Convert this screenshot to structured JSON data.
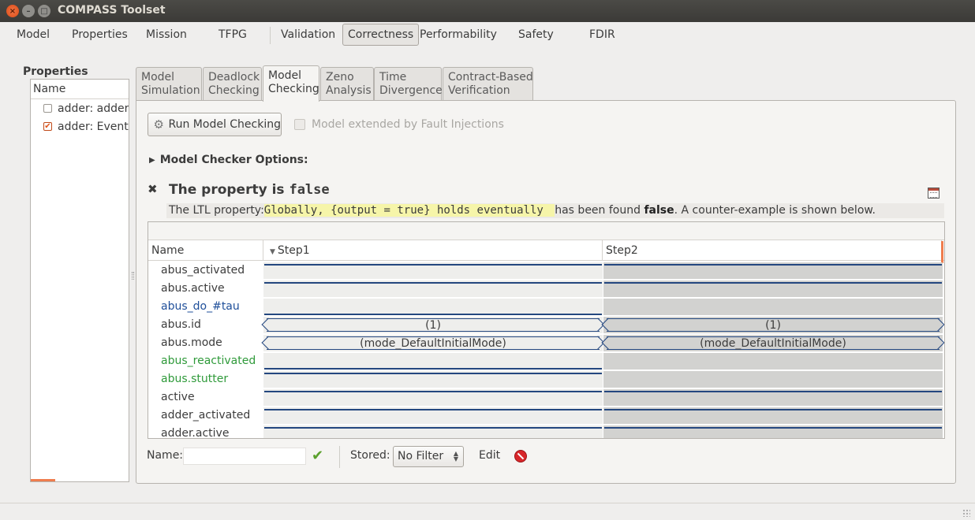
{
  "window": {
    "title": "COMPASS Toolset"
  },
  "menu": {
    "items": [
      "Model",
      "Properties",
      "Mission",
      "TFPG",
      "Validation",
      "Correctness",
      "Performability",
      "Safety",
      "FDIR"
    ],
    "active": "Correctness"
  },
  "properties": {
    "title": "Properties",
    "column": "Name",
    "items": [
      {
        "label": "adder: adder_",
        "checked": false
      },
      {
        "label": "adder: Eventu",
        "checked": true
      }
    ]
  },
  "subtabs": [
    {
      "label": "Model\nSimulation"
    },
    {
      "label": "Deadlock\nChecking"
    },
    {
      "label": "Model\nChecking"
    },
    {
      "label": "Zeno\nAnalysis"
    },
    {
      "label": "Time\nDivergence"
    },
    {
      "label": "Contract-Based\nVerification"
    }
  ],
  "active_subtab": "Model Checking",
  "run_button": "Run Model Checking",
  "fault_checkbox": {
    "label": "Model extended by Fault Injections",
    "checked": false,
    "enabled": false
  },
  "options_label": "Model Checker Options:",
  "result": {
    "title_prefix": "The property is ",
    "title_value": "false",
    "ltl_prefix": "The LTL property:",
    "ltl_formula": "Globally, {output = true} holds eventually ",
    "ltl_mid": " has been found ",
    "ltl_value": "false",
    "ltl_suffix": ". A counter-example is shown below."
  },
  "trace": {
    "headers": {
      "name": "Name",
      "step1": "Step1",
      "step2": "Step2"
    },
    "rows": [
      {
        "name": "abus_activated",
        "color": "default"
      },
      {
        "name": "abus.active",
        "color": "default"
      },
      {
        "name": "abus_do_#tau",
        "color": "blue"
      },
      {
        "name": "abus.id",
        "color": "default",
        "step1": "(1)",
        "step2": "(1)"
      },
      {
        "name": "abus.mode",
        "color": "default",
        "step1": "(mode_DefaultInitialMode)",
        "step2": "(mode_DefaultInitialMode)"
      },
      {
        "name": "abus_reactivated",
        "color": "green"
      },
      {
        "name": "abus.stutter",
        "color": "green"
      },
      {
        "name": "active",
        "color": "default"
      },
      {
        "name": "adder_activated",
        "color": "default"
      },
      {
        "name": "adder.active",
        "color": "default"
      }
    ]
  },
  "filter": {
    "name_label": "Name:",
    "name_value": "",
    "stored_label": "Stored:",
    "stored_value": "No Filter",
    "edit_label": "Edit"
  },
  "colors": {
    "accent": "#ef7d4e",
    "trace_line": "#24477f",
    "highlight": "#f6f5a9"
  }
}
